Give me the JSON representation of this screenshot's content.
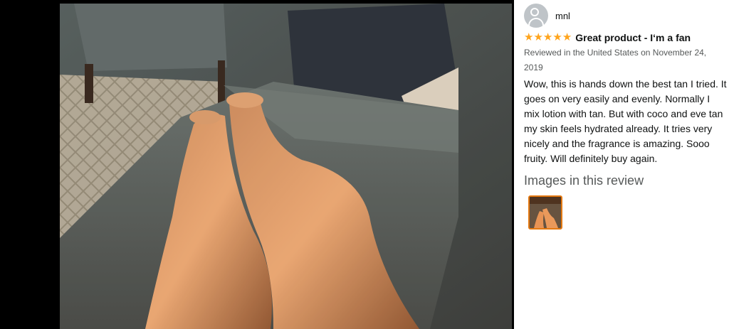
{
  "review": {
    "author": "mnl",
    "rating": 5,
    "rating_max": 5,
    "title": "Great product - I‘m a fan",
    "meta": "Reviewed in the United States on November 24, 2019",
    "body": "Wow, this is hands down the best tan I tried. It goes on very easily and evenly. Normally I mix lotion with tan. But with coco and eve tan my skin feels hydrated already. It tries very nicely and the fragrance is amazing. Sooo fruity. Will definitely buy again.",
    "images_heading": "Images in this review"
  },
  "icons": {
    "avatar": "user-avatar-icon",
    "star": "star-filled-icon"
  },
  "colors": {
    "star": "#ffa41c",
    "thumb_border": "#e47911",
    "viewer_bg": "#000000"
  }
}
